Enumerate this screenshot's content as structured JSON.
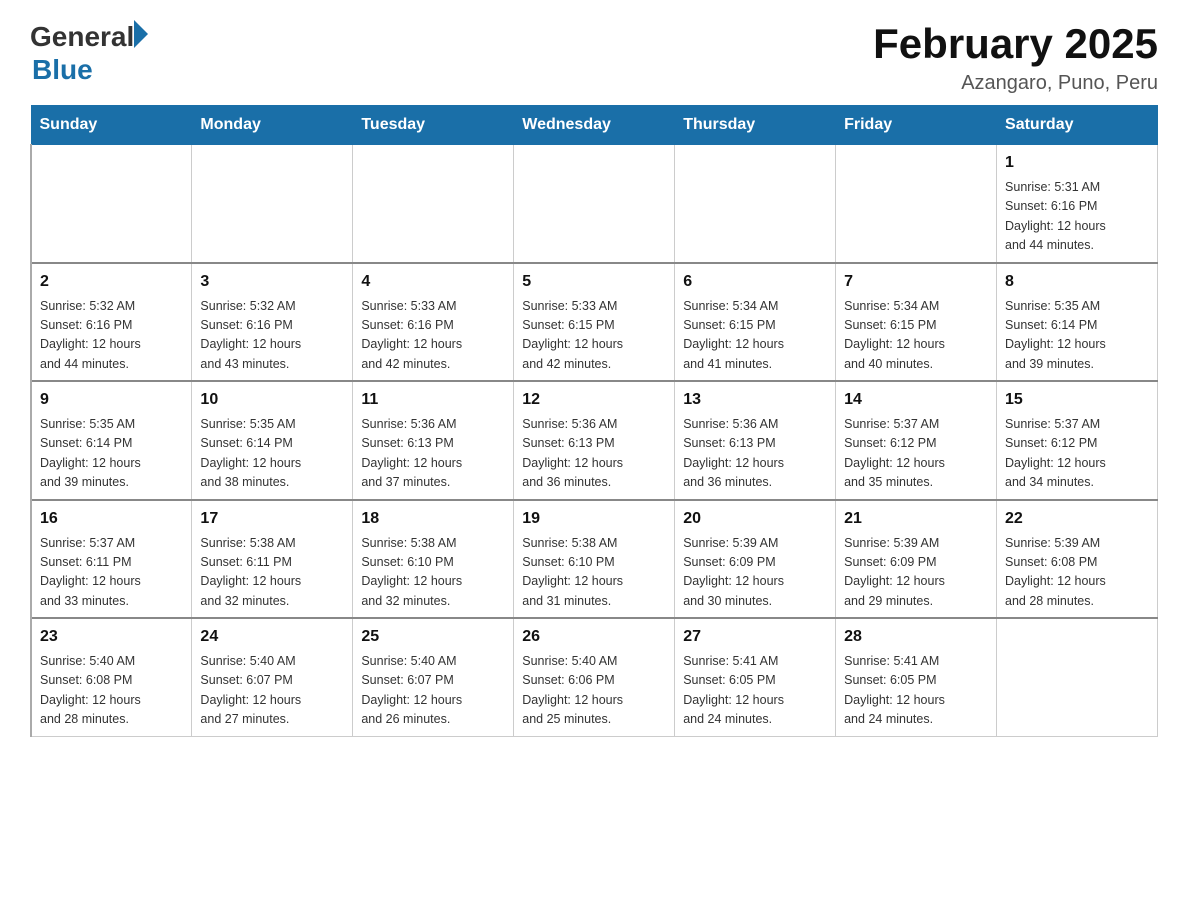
{
  "header": {
    "logo_general": "General",
    "logo_blue": "Blue",
    "title": "February 2025",
    "subtitle": "Azangaro, Puno, Peru"
  },
  "weekdays": [
    "Sunday",
    "Monday",
    "Tuesday",
    "Wednesday",
    "Thursday",
    "Friday",
    "Saturday"
  ],
  "weeks": [
    [
      {
        "day": "",
        "info": ""
      },
      {
        "day": "",
        "info": ""
      },
      {
        "day": "",
        "info": ""
      },
      {
        "day": "",
        "info": ""
      },
      {
        "day": "",
        "info": ""
      },
      {
        "day": "",
        "info": ""
      },
      {
        "day": "1",
        "info": "Sunrise: 5:31 AM\nSunset: 6:16 PM\nDaylight: 12 hours\nand 44 minutes."
      }
    ],
    [
      {
        "day": "2",
        "info": "Sunrise: 5:32 AM\nSunset: 6:16 PM\nDaylight: 12 hours\nand 44 minutes."
      },
      {
        "day": "3",
        "info": "Sunrise: 5:32 AM\nSunset: 6:16 PM\nDaylight: 12 hours\nand 43 minutes."
      },
      {
        "day": "4",
        "info": "Sunrise: 5:33 AM\nSunset: 6:16 PM\nDaylight: 12 hours\nand 42 minutes."
      },
      {
        "day": "5",
        "info": "Sunrise: 5:33 AM\nSunset: 6:15 PM\nDaylight: 12 hours\nand 42 minutes."
      },
      {
        "day": "6",
        "info": "Sunrise: 5:34 AM\nSunset: 6:15 PM\nDaylight: 12 hours\nand 41 minutes."
      },
      {
        "day": "7",
        "info": "Sunrise: 5:34 AM\nSunset: 6:15 PM\nDaylight: 12 hours\nand 40 minutes."
      },
      {
        "day": "8",
        "info": "Sunrise: 5:35 AM\nSunset: 6:14 PM\nDaylight: 12 hours\nand 39 minutes."
      }
    ],
    [
      {
        "day": "9",
        "info": "Sunrise: 5:35 AM\nSunset: 6:14 PM\nDaylight: 12 hours\nand 39 minutes."
      },
      {
        "day": "10",
        "info": "Sunrise: 5:35 AM\nSunset: 6:14 PM\nDaylight: 12 hours\nand 38 minutes."
      },
      {
        "day": "11",
        "info": "Sunrise: 5:36 AM\nSunset: 6:13 PM\nDaylight: 12 hours\nand 37 minutes."
      },
      {
        "day": "12",
        "info": "Sunrise: 5:36 AM\nSunset: 6:13 PM\nDaylight: 12 hours\nand 36 minutes."
      },
      {
        "day": "13",
        "info": "Sunrise: 5:36 AM\nSunset: 6:13 PM\nDaylight: 12 hours\nand 36 minutes."
      },
      {
        "day": "14",
        "info": "Sunrise: 5:37 AM\nSunset: 6:12 PM\nDaylight: 12 hours\nand 35 minutes."
      },
      {
        "day": "15",
        "info": "Sunrise: 5:37 AM\nSunset: 6:12 PM\nDaylight: 12 hours\nand 34 minutes."
      }
    ],
    [
      {
        "day": "16",
        "info": "Sunrise: 5:37 AM\nSunset: 6:11 PM\nDaylight: 12 hours\nand 33 minutes."
      },
      {
        "day": "17",
        "info": "Sunrise: 5:38 AM\nSunset: 6:11 PM\nDaylight: 12 hours\nand 32 minutes."
      },
      {
        "day": "18",
        "info": "Sunrise: 5:38 AM\nSunset: 6:10 PM\nDaylight: 12 hours\nand 32 minutes."
      },
      {
        "day": "19",
        "info": "Sunrise: 5:38 AM\nSunset: 6:10 PM\nDaylight: 12 hours\nand 31 minutes."
      },
      {
        "day": "20",
        "info": "Sunrise: 5:39 AM\nSunset: 6:09 PM\nDaylight: 12 hours\nand 30 minutes."
      },
      {
        "day": "21",
        "info": "Sunrise: 5:39 AM\nSunset: 6:09 PM\nDaylight: 12 hours\nand 29 minutes."
      },
      {
        "day": "22",
        "info": "Sunrise: 5:39 AM\nSunset: 6:08 PM\nDaylight: 12 hours\nand 28 minutes."
      }
    ],
    [
      {
        "day": "23",
        "info": "Sunrise: 5:40 AM\nSunset: 6:08 PM\nDaylight: 12 hours\nand 28 minutes."
      },
      {
        "day": "24",
        "info": "Sunrise: 5:40 AM\nSunset: 6:07 PM\nDaylight: 12 hours\nand 27 minutes."
      },
      {
        "day": "25",
        "info": "Sunrise: 5:40 AM\nSunset: 6:07 PM\nDaylight: 12 hours\nand 26 minutes."
      },
      {
        "day": "26",
        "info": "Sunrise: 5:40 AM\nSunset: 6:06 PM\nDaylight: 12 hours\nand 25 minutes."
      },
      {
        "day": "27",
        "info": "Sunrise: 5:41 AM\nSunset: 6:05 PM\nDaylight: 12 hours\nand 24 minutes."
      },
      {
        "day": "28",
        "info": "Sunrise: 5:41 AM\nSunset: 6:05 PM\nDaylight: 12 hours\nand 24 minutes."
      },
      {
        "day": "",
        "info": ""
      }
    ]
  ]
}
